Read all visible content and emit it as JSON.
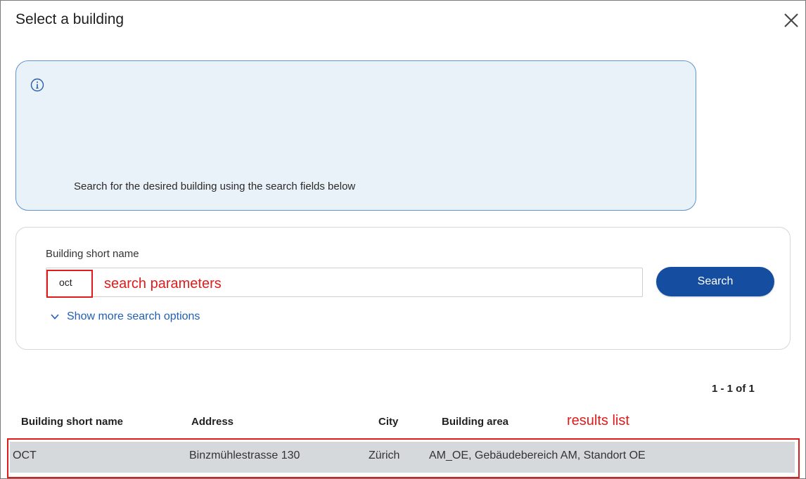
{
  "dialog": {
    "title": "Select a building",
    "close_icon": "close-icon"
  },
  "info": {
    "icon": "info-icon",
    "text": "Search for the desired building using the search fields below"
  },
  "search": {
    "field_label": "Building short name",
    "input_value": "oct",
    "button_label": "Search",
    "more_options_label": "Show more search options"
  },
  "annotations": {
    "search_params": "search parameters",
    "results_list": "results list",
    "color": "#e01b1b"
  },
  "results": {
    "pagination": "1 - 1 of 1",
    "columns": [
      "Building short name",
      "Address",
      "City",
      "Building area"
    ],
    "rows": [
      [
        "OCT",
        "Binzmühlestrasse 130",
        "Zürich",
        "AM_OE, Gebäudebereich AM, Standort OE"
      ]
    ]
  },
  "colors": {
    "accent": "#154ea0",
    "info_bg": "#e9f1f9",
    "row_bg": "#d6d9db"
  }
}
